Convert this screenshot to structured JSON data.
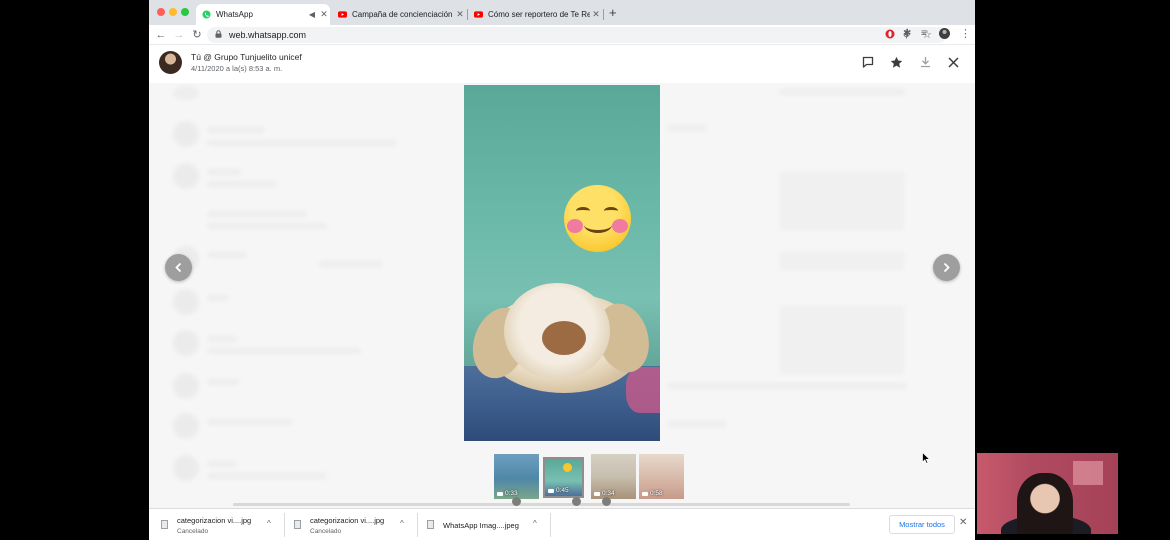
{
  "browser": {
    "tabs": [
      {
        "title": "WhatsApp",
        "favicon": "whatsapp-icon",
        "active": true
      },
      {
        "title": "Campaña de concienciación p",
        "favicon": "youtube-icon",
        "active": false
      },
      {
        "title": "Cómo ser reportero de Te Rec",
        "favicon": "youtube-icon",
        "active": false
      }
    ],
    "new_tab_label": "+",
    "url": "web.whatsapp.com"
  },
  "viewer": {
    "sender": "Tú @ Grupo Tunjuelito unicef",
    "date": "4/11/2020 a la(s) 8:53 a. m.",
    "thumbnails": [
      {
        "duration": "0:33"
      },
      {
        "duration": "0:45",
        "selected": true
      },
      {
        "duration": "0:34"
      },
      {
        "duration": "0:58"
      }
    ]
  },
  "downloads": {
    "items": [
      {
        "name": "categorizacion vi....jpg",
        "status": "Cancelado"
      },
      {
        "name": "categorizacion vi....jpg",
        "status": "Cancelado"
      },
      {
        "name": "WhatsApp Imag....jpeg",
        "status": ""
      }
    ],
    "show_all": "Mostrar todos"
  },
  "colors": {
    "whatsapp_green": "#25d366",
    "youtube_red": "#ff0000",
    "chrome_tabstrip": "#dee1e6",
    "link_blue": "#1a73e8"
  }
}
